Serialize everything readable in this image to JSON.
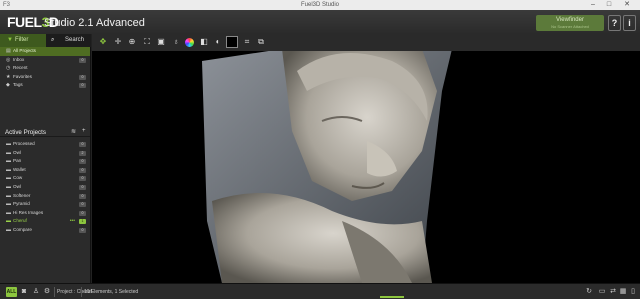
{
  "window": {
    "title": "Fuel3D Studio",
    "app_icon": "F3"
  },
  "header": {
    "logo_text": "FUEL",
    "logo_num": "3",
    "logo_suffix": "D",
    "brand": "Studio 2.1 Advanced",
    "viewfinder_label": "Viewfinder",
    "viewfinder_sub": "No Scanner Attached",
    "help_label": "?",
    "info_label": "i"
  },
  "sidebar": {
    "tabs": [
      {
        "label": "Filter",
        "icon": "funnel-icon"
      },
      {
        "label": "Search",
        "icon": "magnifier-icon"
      }
    ],
    "nav": [
      {
        "label": "All Projects",
        "count": "",
        "selected": true
      },
      {
        "label": "Inbox",
        "count": "0"
      },
      {
        "label": "Recent",
        "count": ""
      },
      {
        "label": "Favorites",
        "count": "0"
      },
      {
        "label": "Tags",
        "count": "0"
      }
    ],
    "projects_title": "Active Projects",
    "projects": [
      {
        "label": "Processed",
        "count": "0"
      },
      {
        "label": "Owl",
        "count": "2"
      },
      {
        "label": "Pan",
        "count": "0"
      },
      {
        "label": "Wallet",
        "count": "0"
      },
      {
        "label": "Cow",
        "count": "0"
      },
      {
        "label": "Owl",
        "count": "0"
      },
      {
        "label": "Softener",
        "count": "0"
      },
      {
        "label": "Pyramid",
        "count": "0"
      },
      {
        "label": "Hi Res Images",
        "count": "0"
      },
      {
        "label": "Cheruf",
        "count": "1",
        "active": true,
        "dots": "•••"
      },
      {
        "label": "Compare",
        "count": "0"
      }
    ]
  },
  "toolbar": {
    "tools": [
      "move-icon",
      "pan-icon",
      "zoom-icon",
      "fit-icon",
      "frame-icon",
      "light-icon",
      "color-wheel-icon",
      "cube-icon",
      "contrast-icon",
      "background-icon",
      "crop-icon",
      "export-icon"
    ]
  },
  "status": {
    "all_label": "ALL",
    "project_label": "Project : Cheruf",
    "selection_label": "10 Elements, 1 Selected"
  },
  "colors": {
    "accent": "#8dc63f",
    "selected": "#4f6d22"
  }
}
